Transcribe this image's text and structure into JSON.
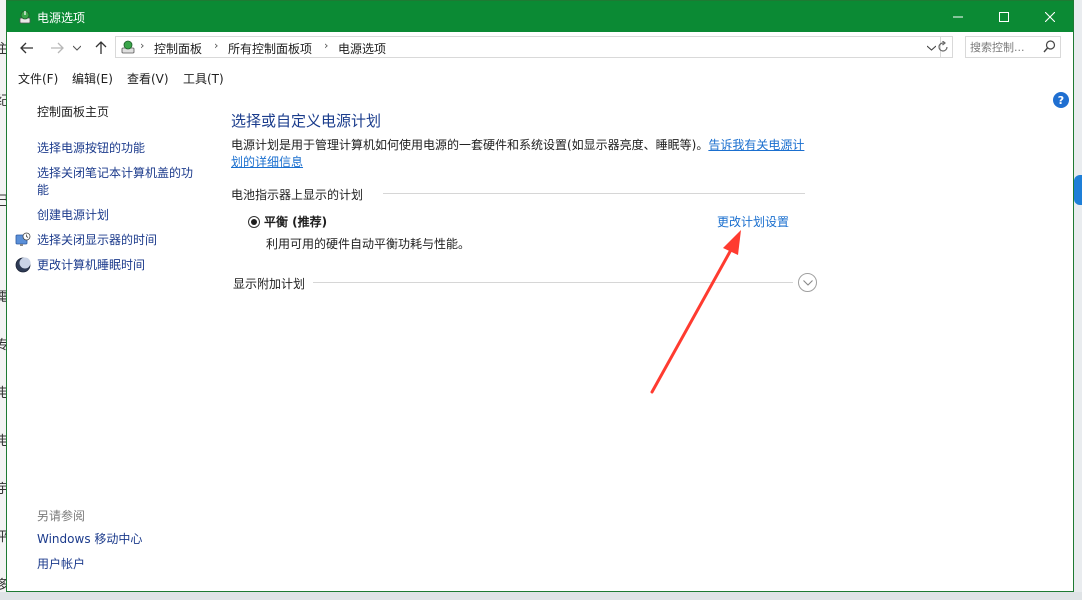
{
  "window": {
    "title": "电源选项",
    "accent_color": "#0b8a34"
  },
  "nav": {
    "breadcrumbs": [
      "控制面板",
      "所有控制面板项",
      "电源选项"
    ],
    "search_placeholder": "搜索控制..."
  },
  "menu": {
    "items": [
      "文件(F)",
      "编辑(E)",
      "查看(V)",
      "工具(T)"
    ]
  },
  "sidebar": {
    "home": "控制面板主页",
    "links": [
      "选择电源按钮的功能",
      "选择关闭笔记本计算机盖的功能",
      "创建电源计划",
      "选择关闭显示器的时间",
      "更改计算机睡眠时间"
    ],
    "see_also_label": "另请参阅",
    "see_also": [
      "Windows 移动中心",
      "用户帐户"
    ]
  },
  "main": {
    "title": "选择或自定义电源计划",
    "description": "电源计划是用于管理计算机如何使用电源的一套硬件和系统设置(如显示器亮度、睡眠等)。",
    "description_link": "告诉我有关电源计划的详细信息",
    "section_battery": "电池指示器上显示的计划",
    "plan_name": "平衡 (推荐)",
    "plan_description": "利用可用的硬件自动平衡功耗与性能。",
    "plan_change_link": "更改计划设置",
    "section_additional": "显示附加计划",
    "link_color": "#1a6fcf",
    "annotation_arrow_color": "#ff3b30"
  },
  "background": {
    "left_glyphs": [
      "主",
      "纪",
      "己",
      "電",
      "专",
      "电",
      "电",
      "宇",
      "平",
      "多"
    ]
  }
}
